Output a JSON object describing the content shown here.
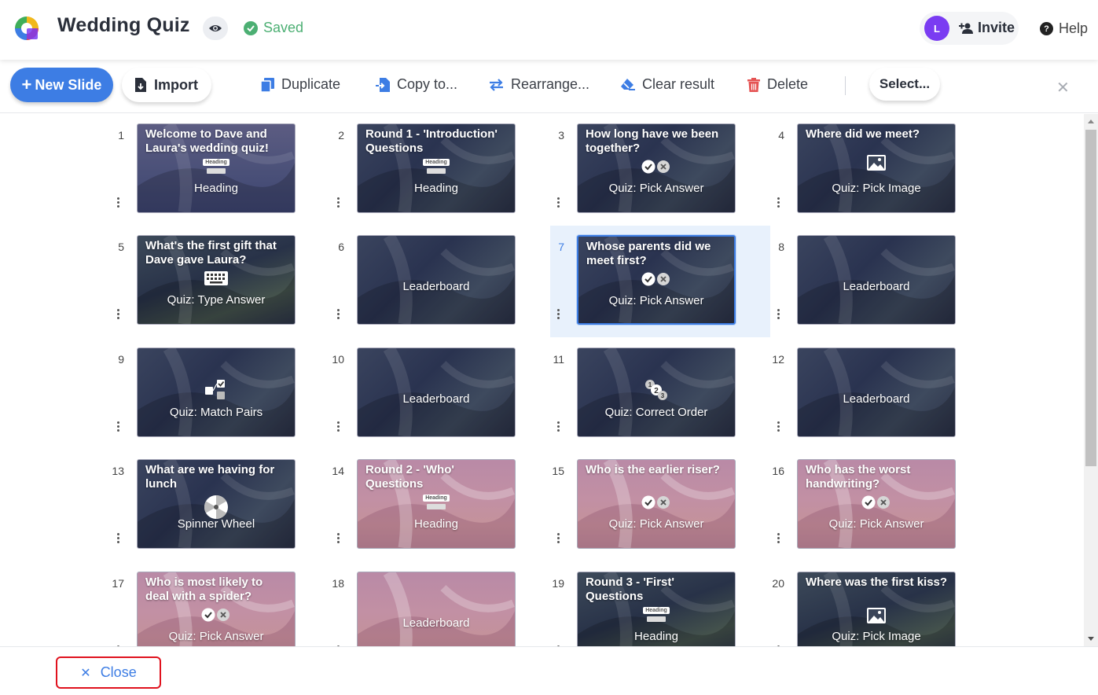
{
  "header": {
    "title": "Wedding Quiz",
    "saved_label": "Saved",
    "avatar_initial": "L",
    "invite_label": "Invite",
    "help_label": "Help",
    "colors": {
      "accent": "#3d7de4",
      "saved": "#4caf73",
      "avatar": "#7a3cf2"
    }
  },
  "toolbar": {
    "new_slide_label": "New Slide",
    "import_label": "Import",
    "duplicate_label": "Duplicate",
    "copy_label": "Copy to...",
    "rearrange_label": "Rearrange...",
    "clear_label": "Clear result",
    "delete_label": "Delete",
    "select_label": "Select..."
  },
  "slides": [
    {
      "num": "1",
      "title": "Welcome to Dave and Laura's wedding quiz!",
      "type": "Heading",
      "icon": "heading-icon",
      "heading_pill": "Heading"
    },
    {
      "num": "2",
      "title": "Round 1 - 'Introduction' Questions",
      "type": "Heading",
      "icon": "heading-icon",
      "heading_pill": "Heading"
    },
    {
      "num": "3",
      "title": "How long have we been together?",
      "type": "Quiz: Pick Answer",
      "icon": "pick-answer-icon"
    },
    {
      "num": "4",
      "title": "Where did we meet?",
      "type": "Quiz: Pick Image",
      "icon": "image-icon"
    },
    {
      "num": "5",
      "title": "What's the first gift that Dave gave Laura?",
      "type": "Quiz: Type Answer",
      "icon": "keyboard-icon"
    },
    {
      "num": "6",
      "title": "",
      "type": "Leaderboard",
      "icon": ""
    },
    {
      "num": "7",
      "title": "Whose parents did we meet first?",
      "type": "Quiz: Pick Answer",
      "icon": "pick-answer-icon"
    },
    {
      "num": "8",
      "title": "",
      "type": "Leaderboard",
      "icon": ""
    },
    {
      "num": "9",
      "title": "",
      "type": "Quiz: Match Pairs",
      "icon": "match-pairs-icon"
    },
    {
      "num": "10",
      "title": "",
      "type": "Leaderboard",
      "icon": ""
    },
    {
      "num": "11",
      "title": "",
      "type": "Quiz: Correct Order",
      "icon": "correct-order-icon"
    },
    {
      "num": "12",
      "title": "",
      "type": "Leaderboard",
      "icon": ""
    },
    {
      "num": "13",
      "title": "What are we having for lunch",
      "type": "Spinner Wheel",
      "icon": "spinner-wheel-icon"
    },
    {
      "num": "14",
      "title": "Round 2 - 'Who' Questions",
      "type": "Heading",
      "icon": "heading-icon",
      "heading_pill": "Heading"
    },
    {
      "num": "15",
      "title": "Who is the earlier riser?",
      "type": "Quiz: Pick Answer",
      "icon": "pick-answer-icon"
    },
    {
      "num": "16",
      "title": "Who has the worst handwriting?",
      "type": "Quiz: Pick Answer",
      "icon": "pick-answer-icon"
    },
    {
      "num": "17",
      "title": "Who is most likely to deal with a spider?",
      "type": "Quiz: Pick Answer",
      "icon": "pick-answer-icon"
    },
    {
      "num": "18",
      "title": "",
      "type": "Leaderboard",
      "icon": ""
    },
    {
      "num": "19",
      "title": "Round 3 - 'First' Questions",
      "type": "Heading",
      "icon": "heading-icon",
      "heading_pill": "Heading"
    },
    {
      "num": "20",
      "title": "Where was the first kiss?",
      "type": "Quiz: Pick Image",
      "icon": "image-icon"
    }
  ],
  "selected_slide": "7",
  "footer": {
    "close_label": "Close"
  }
}
